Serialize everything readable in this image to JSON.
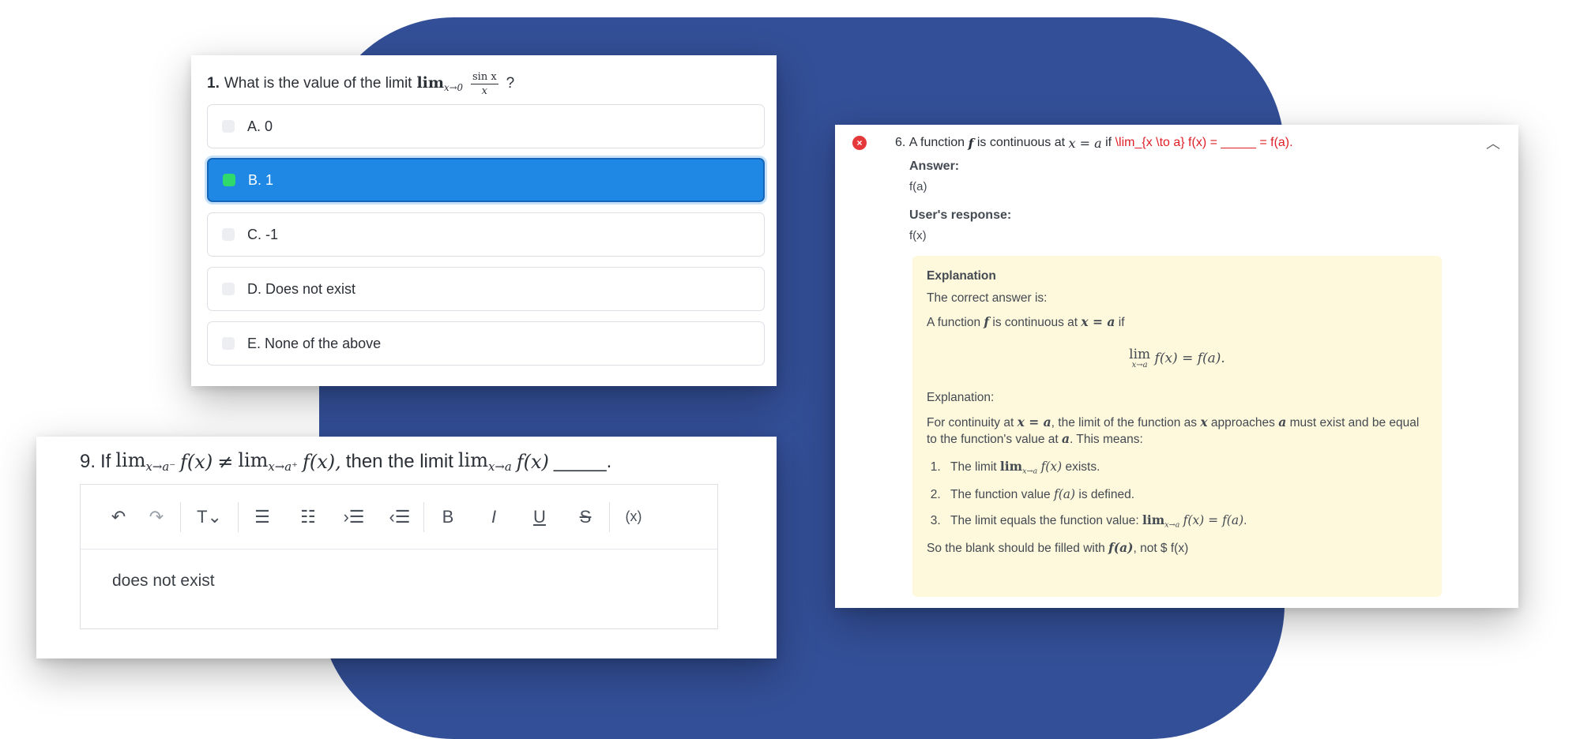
{
  "q1": {
    "number": "1.",
    "prompt": "What is the value of the limit",
    "limit_text": "lim",
    "limit_sub": "x→0",
    "numerator": "sin x",
    "denominator": "x",
    "suffix": "?",
    "options": [
      {
        "label": "A. 0",
        "selected": false
      },
      {
        "label": "B. 1",
        "selected": true
      },
      {
        "label": "C. -1",
        "selected": false
      },
      {
        "label": "D. Does not exist",
        "selected": false
      },
      {
        "label": "E. None of the above",
        "selected": false
      }
    ],
    "colors": {
      "selected_bg": "#1f88e5",
      "selected_box": "#2fd96b"
    }
  },
  "q9": {
    "number": "9.",
    "prefix": "If",
    "lim1": "lim",
    "lim1_sub": "x→a⁻",
    "fx": "f(x)",
    "neq": "≠",
    "lim2": "lim",
    "lim2_sub": "x→a⁺",
    "middle": "then the limit",
    "lim3": "lim",
    "lim3_sub": "x→a",
    "blank": "_____.",
    "toolbar": {
      "undo_icon": "↶",
      "redo_icon": "↷",
      "text_style_icon": "T⌄",
      "bullet_list_icon": "☰",
      "numbered_list_icon": "☷",
      "indent_icon": "›☰",
      "outdent_icon": "‹☰",
      "bold_icon": "B",
      "italic_icon": "I",
      "underline_icon": "U",
      "strike_icon": "S",
      "formula_icon": "(x)"
    },
    "answer_text": "does not exist"
  },
  "q6": {
    "number": "6.",
    "prompt_a": "A function",
    "f": "f",
    "prompt_b": "is continuous at",
    "cond": "x = a",
    "prompt_c": "if",
    "raw_latex": "\\lim_{x \\to a} f(x) = _____ = f(a).",
    "answer_label": "Answer:",
    "answer_value": "f(a)",
    "response_label": "User's response:",
    "response_value": "f(x)",
    "explanation": {
      "title": "Explanation",
      "correct_intro": "The correct answer is:",
      "line1_a": "A function",
      "line1_f": "f",
      "line1_b": "is continuous at",
      "line1_cond": "x = a",
      "line1_c": "if",
      "display_lim": "lim",
      "display_sub": "x→a",
      "display_eq": "f(x) = f(a).",
      "sub_title": "Explanation:",
      "para_a": "For continuity at",
      "para_cond": "x = a",
      "para_b": ", the limit of the function as",
      "para_x": "x",
      "para_c": "approaches",
      "para_a2": "a",
      "para_d": "must exist and be equal to the function's value at",
      "para_a3": "a",
      "para_e": ". This means:",
      "items": [
        {
          "a": "The limit",
          "math": "lim",
          "sub": "x→a",
          "b": "f(x)",
          "c": "exists."
        },
        {
          "a": "The function value",
          "math": "",
          "sub": "",
          "b": "f(a)",
          "c": "is defined."
        },
        {
          "a": "The limit equals the function value:",
          "math": "lim",
          "sub": "x→a",
          "b": "f(x) = f(a)",
          "c": "."
        }
      ],
      "closing_a": "So the blank should be filled with",
      "closing_math": "f(a)",
      "closing_b": ", not $ f(x)"
    },
    "colors": {
      "error": "#e5383b",
      "latex_red": "#e01e26",
      "explain_bg": "#fef8dc"
    }
  }
}
